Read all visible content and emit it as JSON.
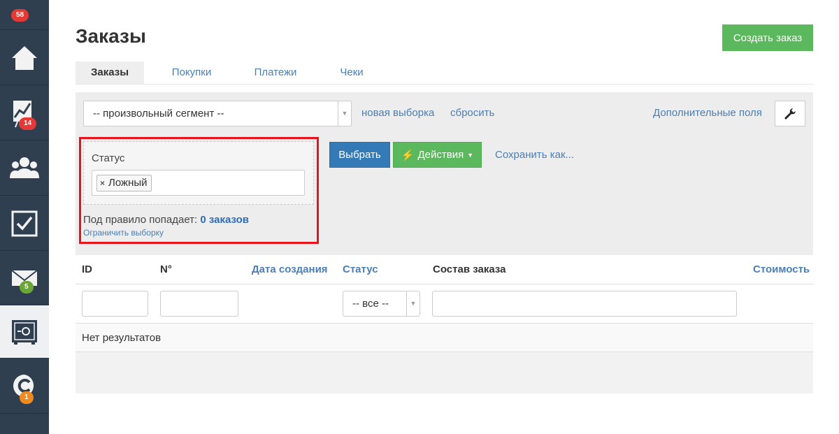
{
  "sidebar": {
    "top_badge": "58",
    "items": [
      {
        "icon": "home-icon",
        "badge": ""
      },
      {
        "icon": "chart-icon",
        "badge": "14"
      },
      {
        "icon": "users-icon",
        "badge": ""
      },
      {
        "icon": "checkbox-icon",
        "badge": ""
      },
      {
        "icon": "mail-icon",
        "badge": "5"
      },
      {
        "icon": "safe-icon",
        "badge": ""
      },
      {
        "icon": "chat-icon",
        "badge": "1"
      }
    ]
  },
  "header": {
    "title": "Заказы",
    "create_button": "Создать заказ"
  },
  "tabs": [
    {
      "label": "Заказы",
      "active": true
    },
    {
      "label": "Покупки",
      "active": false
    },
    {
      "label": "Платежи",
      "active": false
    },
    {
      "label": "Чеки",
      "active": false
    }
  ],
  "filter": {
    "segment_select": "-- произвольный сегмент --",
    "new_selection": "новая выборка",
    "reset": "сбросить",
    "extra_fields": "Дополнительные поля",
    "rule": {
      "label": "Статус",
      "tag": "Ложный",
      "count_prefix": "Под правило попадает:",
      "count_value": "0 заказов",
      "limit_link": "Ограничить выборку"
    },
    "select_button": "Выбрать",
    "actions_button": "Действия",
    "save_as": "Сохранить как..."
  },
  "table": {
    "columns": [
      "ID",
      "N°",
      "Дата создания",
      "Статус",
      "Состав заказа",
      "Стоимость"
    ],
    "status_filter": "-- все --",
    "empty_text": "Нет результатов"
  },
  "colors": {
    "sidebar": "#2f3f4f",
    "accent_green": "#5cb85c",
    "accent_blue": "#337ab7",
    "link": "#4a7fb5",
    "highlight": "#e8141b"
  }
}
